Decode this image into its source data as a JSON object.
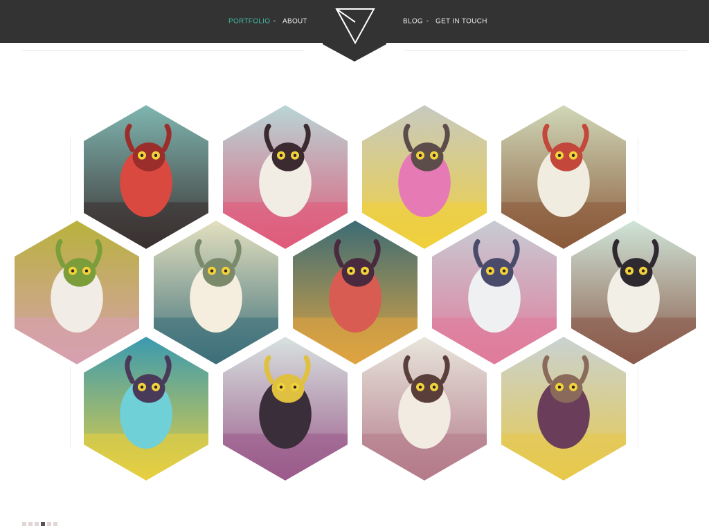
{
  "nav": {
    "items": [
      {
        "label": "PORTFOLIO",
        "active": true
      },
      {
        "label": "ABOUT",
        "active": false
      },
      {
        "label": "BLOG",
        "active": false
      },
      {
        "label": "GET IN TOUCH",
        "active": false
      }
    ],
    "accent_color": "#3fb9a0",
    "bar_color": "#333333"
  },
  "logo": {
    "icon": "triangle-logo-icon"
  },
  "portfolio": {
    "tiles": [
      {
        "subject": "red-horned-cyclops-monster",
        "colors": [
          "#7fb6b0",
          "#d9493f",
          "#9b2d2a",
          "#3a3030"
        ]
      },
      {
        "subject": "fluffy-sheep-monster-flying",
        "colors": [
          "#b8d6d6",
          "#f1ece4",
          "#3b2a30",
          "#e05a7a"
        ]
      },
      {
        "subject": "pink-cow-monster-mountains",
        "colors": [
          "#c7c9c0",
          "#e67ab5",
          "#5c4c4a",
          "#f1d03a"
        ]
      },
      {
        "subject": "white-monster-tangled-strings",
        "colors": [
          "#cfd8b8",
          "#f0ece0",
          "#c3473a",
          "#8a5a3a"
        ]
      },
      {
        "subject": "unicorn-pig-lying-in-grass",
        "colors": [
          "#b8b23c",
          "#f2ece6",
          "#7b9e3a",
          "#d7a0b0"
        ]
      },
      {
        "subject": "deer-creatures-in-forest",
        "colors": [
          "#e4e0bf",
          "#f5eede",
          "#7a8a6a",
          "#3d6f7a"
        ]
      },
      {
        "subject": "octopus-and-creatures-scene",
        "colors": [
          "#3c6c75",
          "#d85c52",
          "#4a2a3e",
          "#e0a440"
        ]
      },
      {
        "subject": "two-yetis-with-horns",
        "colors": [
          "#c7ccd4",
          "#eef0f2",
          "#4a4a6a",
          "#e07a9a"
        ]
      },
      {
        "subject": "hooded-white-ape-on-branch",
        "colors": [
          "#cfe5d8",
          "#f2efe6",
          "#2f2a30",
          "#8a5a4a"
        ]
      },
      {
        "subject": "jellyfish-underwater",
        "colors": [
          "#3a9ab0",
          "#6fd0d8",
          "#4a3a5a",
          "#e8d040"
        ]
      },
      {
        "subject": "tribal-mask-monster",
        "colors": [
          "#d8e2e0",
          "#3a2e3a",
          "#e0c040",
          "#9a5a8a"
        ]
      },
      {
        "subject": "bird-and-cat-creature",
        "colors": [
          "#e8e6dc",
          "#f2ebe2",
          "#5a3e3a",
          "#b47a8a"
        ]
      },
      {
        "subject": "horned-purple-creature-landscape",
        "colors": [
          "#c9d2d2",
          "#6a3e5a",
          "#8a6a5a",
          "#e8c84a"
        ]
      }
    ]
  },
  "pager": {
    "count": 6,
    "active_index": 3
  }
}
